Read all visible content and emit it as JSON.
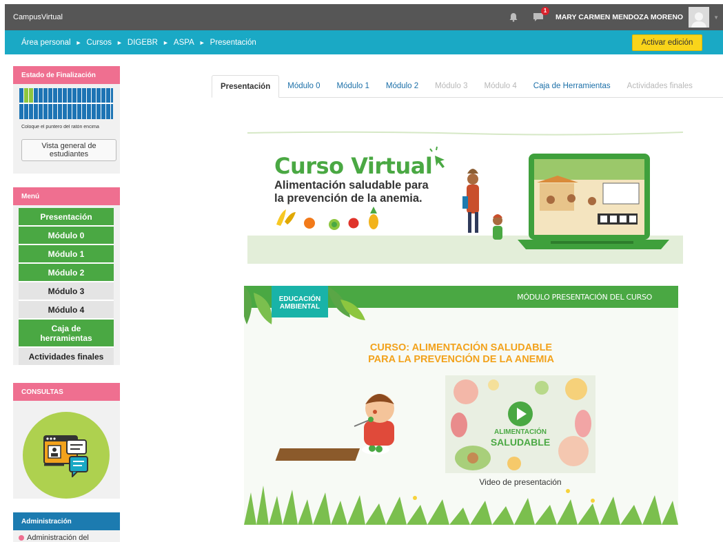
{
  "topbar": {
    "brand": "CampusVirtual",
    "notification_count": "1",
    "username": "MARY CARMEN MENDOZA MORENO",
    "icons": [
      "bell-icon",
      "chat-icon",
      "avatar-icon",
      "chevron-down-icon"
    ]
  },
  "breadcrumb": {
    "items": [
      "Área personal",
      "Cursos",
      "DIGEBR",
      "ASPA",
      "Presentación"
    ],
    "edit_button": "Activar edición"
  },
  "completion_block": {
    "title": "Estado de Finalización",
    "hint": "Coloque el puntero del ratón encima",
    "overview_button": "Vista general de estudiantes"
  },
  "menu_block": {
    "title": "Menú",
    "items": [
      {
        "label": "Presentación",
        "state": "active"
      },
      {
        "label": "Módulo 0",
        "state": "active"
      },
      {
        "label": "Módulo 1",
        "state": "active"
      },
      {
        "label": "Módulo 2",
        "state": "active"
      },
      {
        "label": "Módulo 3",
        "state": "inactive"
      },
      {
        "label": "Módulo 4",
        "state": "inactive"
      },
      {
        "label": "Caja de herramientas",
        "state": "active"
      },
      {
        "label": "Actividades finales",
        "state": "inactive"
      }
    ]
  },
  "consultas_block": {
    "title": "CONSULTAS"
  },
  "admin_block": {
    "title": "Administración",
    "first_item": "Administración del"
  },
  "tabs": [
    {
      "label": "Presentación",
      "state": "active"
    },
    {
      "label": "Módulo 0",
      "state": "enabled"
    },
    {
      "label": "Módulo 1",
      "state": "enabled"
    },
    {
      "label": "Módulo 2",
      "state": "enabled"
    },
    {
      "label": "Módulo 3",
      "state": "disabled"
    },
    {
      "label": "Módulo 4",
      "state": "disabled"
    },
    {
      "label": "Caja de Herramientas",
      "state": "enabled"
    },
    {
      "label": "Actividades finales",
      "state": "disabled"
    }
  ],
  "banner_course": {
    "title": "Curso Virtual",
    "subtitle_line1": "Alimentación saludable para",
    "subtitle_line2": "la prevención de la anemia."
  },
  "banner_module": {
    "badge_line1": "EDUCACIÓN",
    "badge_line2": "AMBIENTAL",
    "strip_label": "MÓDULO PRESENTACIÓN DEL CURSO",
    "title_line1": "CURSO: ALIMENTACIÓN SALUDABLE",
    "title_line2": "PARA LA PREVENCIÓN DE LA ANEMIA",
    "video_text_line1": "ALIMENTACIÓN",
    "video_text_line2": "SALUDABLE",
    "video_label": "Video de presentación"
  },
  "colors": {
    "topbar": "#565656",
    "breadcrumb_bar": "#1aa9c5",
    "edit_button": "#f9d41a",
    "block_header_pink": "#ef6f90",
    "block_header_blue": "#1c7bb0",
    "menu_green": "#4aa843",
    "menu_gray": "#e4e4e4",
    "title_orange": "#f2a21c"
  }
}
